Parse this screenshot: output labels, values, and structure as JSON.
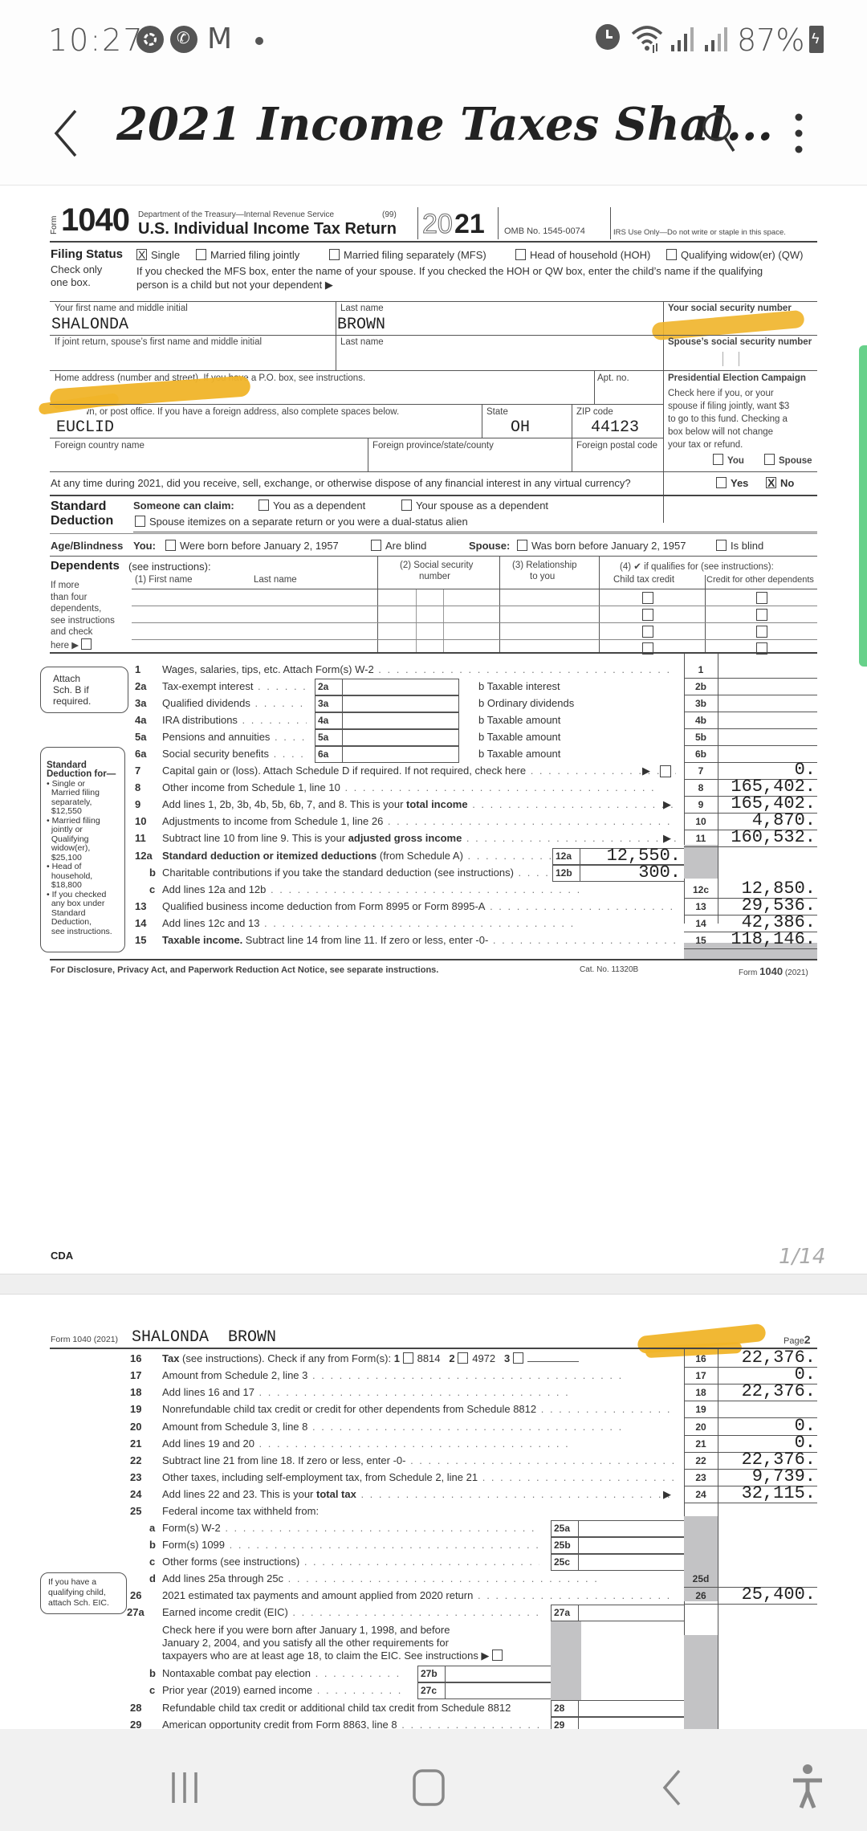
{
  "status_bar": {
    "time": "10:27",
    "left_icons": [
      "camera-aperture-icon",
      "whatsapp-icon",
      "gmail-icon",
      "dot-icon"
    ],
    "right_icons": [
      "alarm-icon",
      "wifi-icon",
      "signal-icon",
      "signal-icon"
    ],
    "battery": "87%"
  },
  "app_bar": {
    "title": "2021 Income Taxes Shal...",
    "back_icon": "back-chevron-icon",
    "search_icon": "search-icon",
    "more_icon": "more-vertical-icon"
  },
  "page1": {
    "header": {
      "form_word": "Form",
      "form_number": "1040",
      "dept": "Department of the Treasury—Internal Revenue Service",
      "code": "(99)",
      "title": "U.S. Individual Income Tax Return",
      "year_outline": "20",
      "year_bold": "21",
      "omb": "OMB No. 1545-0074",
      "irs_use": "IRS Use Only—Do not write or staple in this space."
    },
    "filing_status": {
      "heading": "Filing Status",
      "sub1": "Check only",
      "sub2": "one box.",
      "options": [
        {
          "label": "Single",
          "checked": true
        },
        {
          "label": "Married filing jointly",
          "checked": false
        },
        {
          "label": "Married filing separately (MFS)",
          "checked": false
        },
        {
          "label": "Head of household (HOH)",
          "checked": false
        },
        {
          "label": "Qualifying widow(er) (QW)",
          "checked": false
        }
      ],
      "note1": "If you checked the MFS box, enter the name of your spouse. If you checked the HOH or QW box, enter the child’s name if the qualifying",
      "note2": "person is a child but not your dependent ▶"
    },
    "name": {
      "first_label": "Your first name and middle initial",
      "first_value": "SHALONDA",
      "last_label": "Last name",
      "last_value": "BROWN",
      "ssn_label": "Your social security number",
      "spouse_first_label": "If joint return, spouse’s first name and middle initial",
      "spouse_last_label": "Last name",
      "spouse_ssn_label": "Spouse’s social security number"
    },
    "address": {
      "home_label": "Home address (number and street). If you have a P.O. box, see instructions.",
      "apt_label": "Apt. no.",
      "city_label": "City, town, or post office. If you have a foreign address, also complete spaces below.",
      "city_value": "EUCLID",
      "state_label": "State",
      "state_value": "OH",
      "zip_label": "ZIP code",
      "zip_value": "44123",
      "country_label": "Foreign country name",
      "province_label": "Foreign province/state/county",
      "postal_label": "Foreign postal code"
    },
    "presidential": {
      "heading": "Presidential Election Campaign",
      "lines": [
        "Check here if you, or your",
        "spouse if filing jointly, want $3",
        "to go to this fund. Checking a",
        "box below will not change",
        "your tax or refund."
      ],
      "you": "You",
      "spouse": "Spouse"
    },
    "virtual_currency": {
      "question": "At any time during 2021, did you receive, sell, exchange, or otherwise dispose of any financial interest in any virtual currency?",
      "yes": "Yes",
      "no": "No",
      "answer": "No"
    },
    "standard_deduction": {
      "heading1": "Standard",
      "heading2": "Deduction",
      "someone": "Someone can claim:",
      "opt1": "You as a dependent",
      "opt2": "Your spouse as a dependent",
      "opt3": "Spouse itemizes on a separate return or you were a dual-status alien"
    },
    "age_blindness": {
      "heading": "Age/Blindness",
      "you": "You:",
      "opt1": "Were born before January 2, 1957",
      "opt2": "Are blind",
      "spouse": "Spouse:",
      "opt3": "Was born before January 2, 1957",
      "opt4": "Is blind"
    },
    "dependents": {
      "heading": "Dependents",
      "see": "(see instructions):",
      "col1": "(1) First name",
      "col1b": "Last name",
      "col2a": "(2) Social security",
      "col2b": "number",
      "col3a": "(3) Relationship",
      "col3b": "to you",
      "col4": "(4) ✔ if qualifies for (see instructions):",
      "col4a": "Child tax credit",
      "col4b": "Credit for other dependents",
      "side": [
        "If more",
        "than four",
        "dependents,",
        "see instructions",
        "and check",
        "here ▶"
      ]
    },
    "attach_note": [
      "Attach",
      "Sch. B if",
      "required."
    ],
    "std_side": {
      "heading": [
        "Standard",
        "Deduction for—"
      ],
      "items": [
        "• Single or",
        "  Married filing",
        "  separately,",
        "  $12,550",
        "• Married filing",
        "  jointly or",
        "  Qualifying",
        "  widow(er),",
        "  $25,100",
        "• Head of",
        "  household,",
        "  $18,800",
        "• If you checked",
        "  any box under",
        "  Standard",
        "  Deduction,",
        "  see instructions."
      ]
    },
    "lines": [
      {
        "num": "1",
        "text": "Wages, salaries, tips, etc. Attach Form(s) W-2",
        "box": "1",
        "value": ""
      },
      {
        "num": "2a",
        "text": "Tax-exempt interest",
        "inner": "2a",
        "btext": "b Taxable interest",
        "box": "2b",
        "value": ""
      },
      {
        "num": "3a",
        "text": "Qualified dividends",
        "inner": "3a",
        "btext": "b Ordinary dividends",
        "box": "3b",
        "value": ""
      },
      {
        "num": "4a",
        "text": "IRA distributions",
        "inner": "4a",
        "btext": "b Taxable amount",
        "box": "4b",
        "value": ""
      },
      {
        "num": "5a",
        "text": "Pensions and annuities",
        "inner": "5a",
        "btext": "b Taxable amount",
        "box": "5b",
        "value": ""
      },
      {
        "num": "6a",
        "text": "Social security benefits",
        "inner": "6a",
        "btext": "b Taxable amount",
        "box": "6b",
        "value": ""
      },
      {
        "num": "7",
        "text": "Capital gain or (loss). Attach Schedule D if required. If not required, check here",
        "box": "7",
        "value": "0."
      },
      {
        "num": "8",
        "text": "Other income from Schedule 1, line 10",
        "box": "8",
        "value": "165,402."
      },
      {
        "num": "9",
        "text": "Add lines 1, 2b, 3b, 4b, 5b, 6b, 7, and 8. This is your ",
        "bold": "total income",
        "box": "9",
        "value": "165,402."
      },
      {
        "num": "10",
        "text": "Adjustments to income from Schedule 1, line 26",
        "box": "10",
        "value": "4,870."
      },
      {
        "num": "11",
        "text": "Subtract line 10 from line 9. This is your ",
        "bold": "adjusted gross income",
        "box": "11",
        "value": "160,532."
      },
      {
        "num": "12a",
        "boldlead": "Standard deduction or itemized deductions",
        "text": " (from Schedule A)",
        "inner": "12a",
        "inner_value": "12,550."
      },
      {
        "num": "b",
        "text": "Charitable contributions if you take the standard deduction (see instructions)",
        "inner": "12b",
        "inner_value": "300."
      },
      {
        "num": "c",
        "text": "Add lines 12a and 12b",
        "box": "12c",
        "value": "12,850."
      },
      {
        "num": "13",
        "text": "Qualified business income deduction from Form 8995 or Form 8995-A",
        "box": "13",
        "value": "29,536."
      },
      {
        "num": "14",
        "text": "Add lines 12c and 13",
        "box": "14",
        "value": "42,386."
      },
      {
        "num": "15",
        "boldlead": "Taxable income.",
        "text": " Subtract line 14 from line 11. If zero or less, enter -0-",
        "box": "15",
        "value": "118,146."
      }
    ],
    "footer": {
      "notice": "For Disclosure, Privacy Act, and Paperwork Reduction Act Notice, see separate instructions.",
      "cat": "Cat. No. 11320B",
      "form": "Form",
      "form_num": "1040",
      "form_year": "(2021)"
    },
    "cda": "CDA",
    "page_indicator": "1/14"
  },
  "page2": {
    "header_form": "Form 1040 (2021)",
    "header_name": "SHALONDA  BROWN",
    "page_label": "Page",
    "page_num": "2",
    "line16": {
      "num": "16",
      "bold": "Tax",
      "text": " (see instructions). Check if any from Form(s):",
      "c1": "1",
      "f1": "8814",
      "c2": "2",
      "f2": "4972",
      "c3": "3",
      "box": "16",
      "value": "22,376."
    },
    "lines": [
      {
        "num": "17",
        "text": "Amount from Schedule 2, line 3",
        "box": "17",
        "value": "0."
      },
      {
        "num": "18",
        "text": "Add lines 16 and 17",
        "box": "18",
        "value": "22,376."
      },
      {
        "num": "19",
        "text": "Nonrefundable child tax credit or credit for other dependents from Schedule 8812",
        "box": "19",
        "value": ""
      },
      {
        "num": "20",
        "text": "Amount from Schedule 3, line 8",
        "box": "20",
        "value": "0."
      },
      {
        "num": "21",
        "text": "Add lines 19 and 20",
        "box": "21",
        "value": "0."
      },
      {
        "num": "22",
        "text": "Subtract line 21 from line 18. If zero or less, enter -0-",
        "box": "22",
        "value": "22,376."
      },
      {
        "num": "23",
        "text": "Other taxes, including self-employment tax, from Schedule 2, line 21",
        "box": "23",
        "value": "9,739."
      },
      {
        "num": "24",
        "text": "Add lines 22 and 23. This is your ",
        "bold": "total tax",
        "box": "24",
        "value": "32,115."
      }
    ],
    "line25": {
      "num": "25",
      "text": "Federal income tax withheld from:"
    },
    "line25abc": [
      {
        "num": "a",
        "text": "Form(s) W-2",
        "inner": "25a"
      },
      {
        "num": "b",
        "text": "Form(s) 1099",
        "inner": "25b"
      },
      {
        "num": "c",
        "text": "Other forms (see instructions)",
        "inner": "25c"
      }
    ],
    "line25d": {
      "num": "d",
      "text": "Add lines 25a through 25c",
      "box": "25d",
      "value": ""
    },
    "line26": {
      "num": "26",
      "text": "2021 estimated tax payments and amount applied from 2020 return",
      "box": "26",
      "value": "25,400."
    },
    "eic_side": [
      "If you have a",
      "qualifying child,",
      "attach Sch. EIC."
    ],
    "line27a": {
      "num": "27a",
      "text": "Earned income credit (EIC)",
      "inner": "27a"
    },
    "eic_check": [
      "Check here if you were born after January 1, 1998, and before",
      "January 2, 2004, and you satisfy all the other requirements for",
      "taxpayers who are at least age 18, to claim the EIC. See instructions ▶"
    ],
    "line27b": {
      "num": "b",
      "text": "Nontaxable combat pay election",
      "inner": "27b"
    },
    "line27c": {
      "num": "c",
      "text": "Prior year (2019) earned income",
      "inner": "27c"
    },
    "line28": {
      "num": "28",
      "text": "Refundable child tax credit or additional child tax credit from Schedule 8812",
      "inner": "28"
    },
    "line29": {
      "num": "29",
      "text": "American opportunity credit from Form 8863, line 8",
      "inner": "29"
    }
  },
  "nav_bar": {
    "recents": "recents-icon",
    "home": "home-icon",
    "back": "back-icon",
    "accessibility": "accessibility-icon"
  },
  "colors": {
    "redaction": "#f0b429",
    "scroll_thumb": "#67d18a",
    "shaded_cell": "#c3c3c5"
  }
}
